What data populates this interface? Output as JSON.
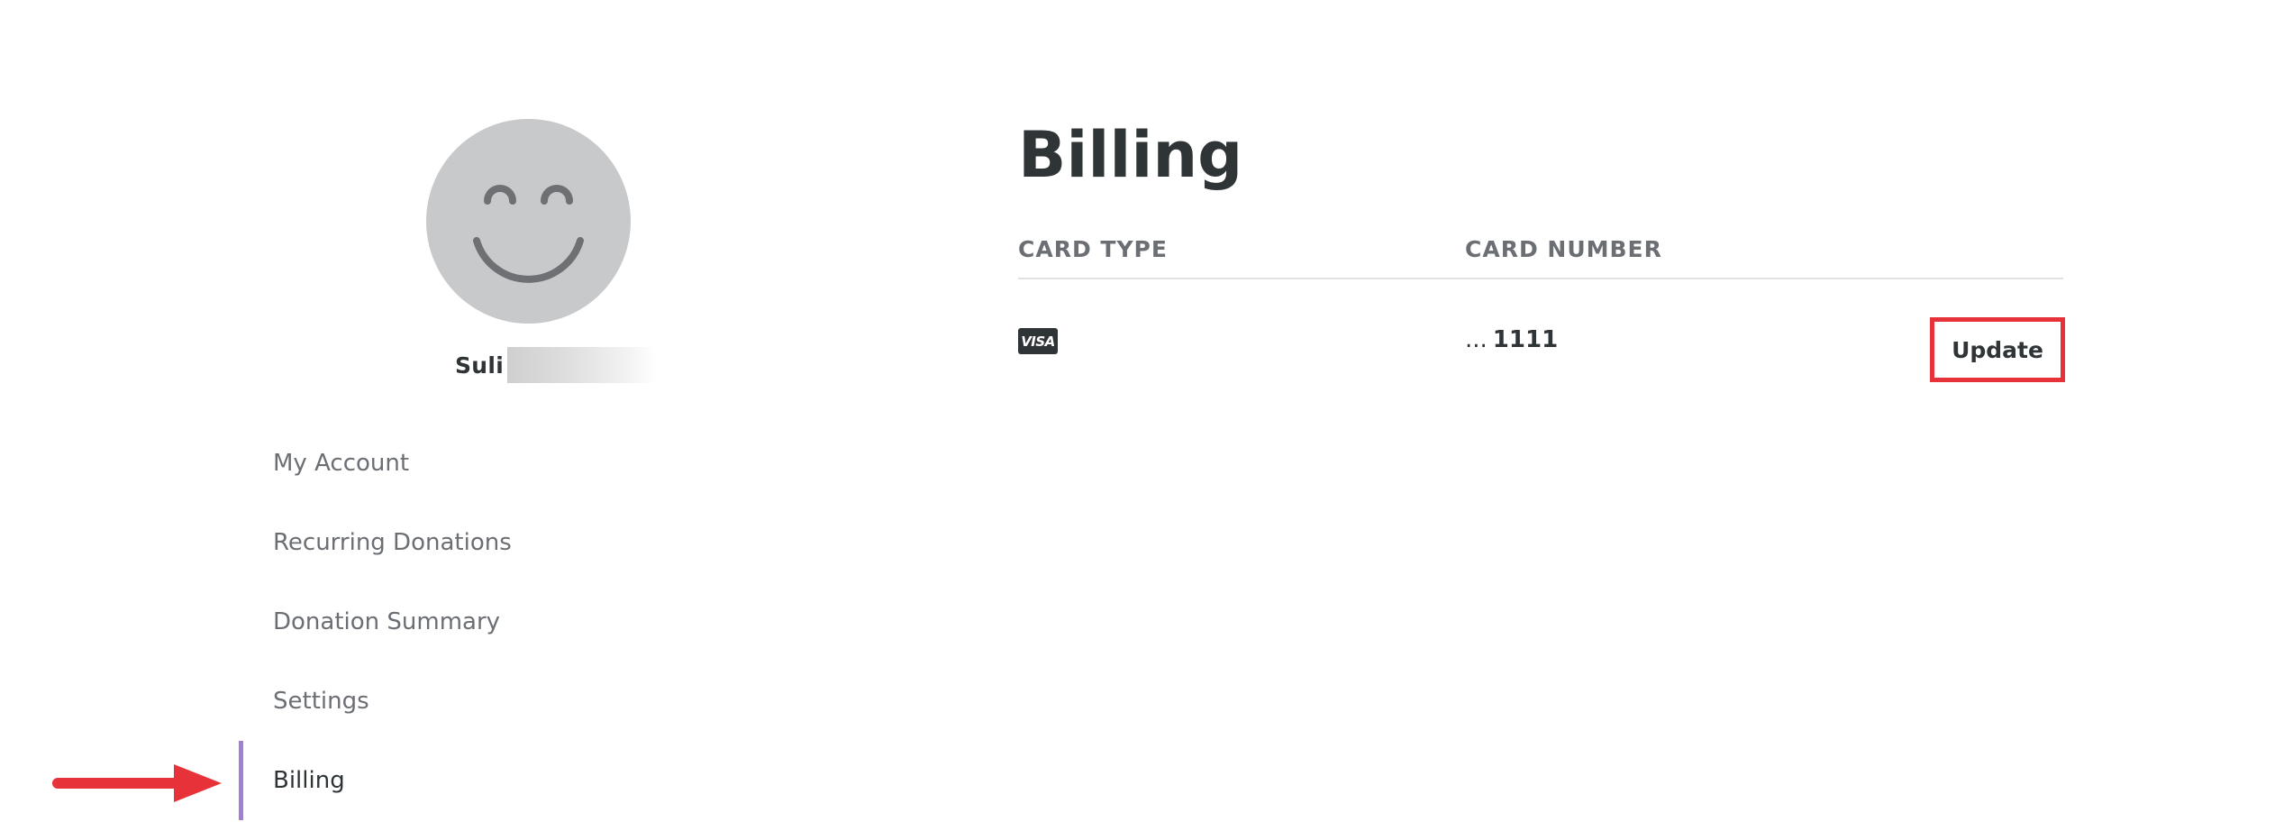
{
  "profile": {
    "name_visible": "Suli",
    "avatar_icon": "smiley-face-icon"
  },
  "sidebar": {
    "items": [
      {
        "label": "My Account",
        "active": false
      },
      {
        "label": "Recurring Donations",
        "active": false
      },
      {
        "label": "Donation Summary",
        "active": false
      },
      {
        "label": "Settings",
        "active": false
      },
      {
        "label": "Billing",
        "active": true
      }
    ]
  },
  "main": {
    "title": "Billing",
    "columns": {
      "card_type": "CARD TYPE",
      "card_number": "CARD NUMBER"
    },
    "rows": [
      {
        "card_type": "VISA",
        "card_type_icon": "visa-icon",
        "number_prefix": "...",
        "number_last4": "1111",
        "action_label": "Update"
      }
    ]
  },
  "annotations": {
    "arrow_icon": "red-arrow-icon",
    "highlight_color": "#e8323a"
  },
  "colors": {
    "accent": "#a17fd6",
    "text_dark": "#2f3437",
    "text_muted": "#6b6f73",
    "avatar_bg": "#c8c9cb",
    "avatar_face": "#6e7073"
  }
}
